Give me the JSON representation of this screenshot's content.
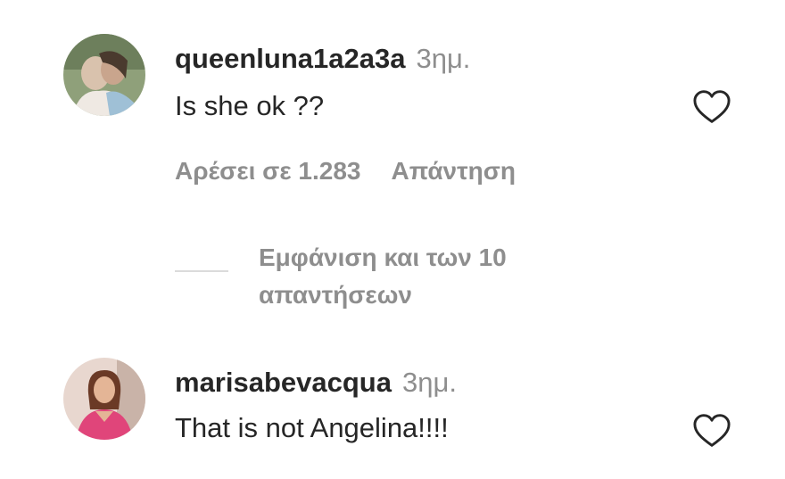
{
  "comments": [
    {
      "username": "queenluna1a2a3a",
      "timestamp": "3ημ.",
      "text": "Is she ok ??",
      "likes_label": "Αρέσει σε 1.283",
      "reply_label": "Απάντηση",
      "view_replies_label": "Εμφάνιση και των 10 απαντήσεων",
      "like_icon": "heart-outline-icon"
    },
    {
      "username": "marisabevacqua",
      "timestamp": "3ημ.",
      "text": "That is not Angelina!!!!",
      "like_icon": "heart-outline-icon"
    }
  ]
}
